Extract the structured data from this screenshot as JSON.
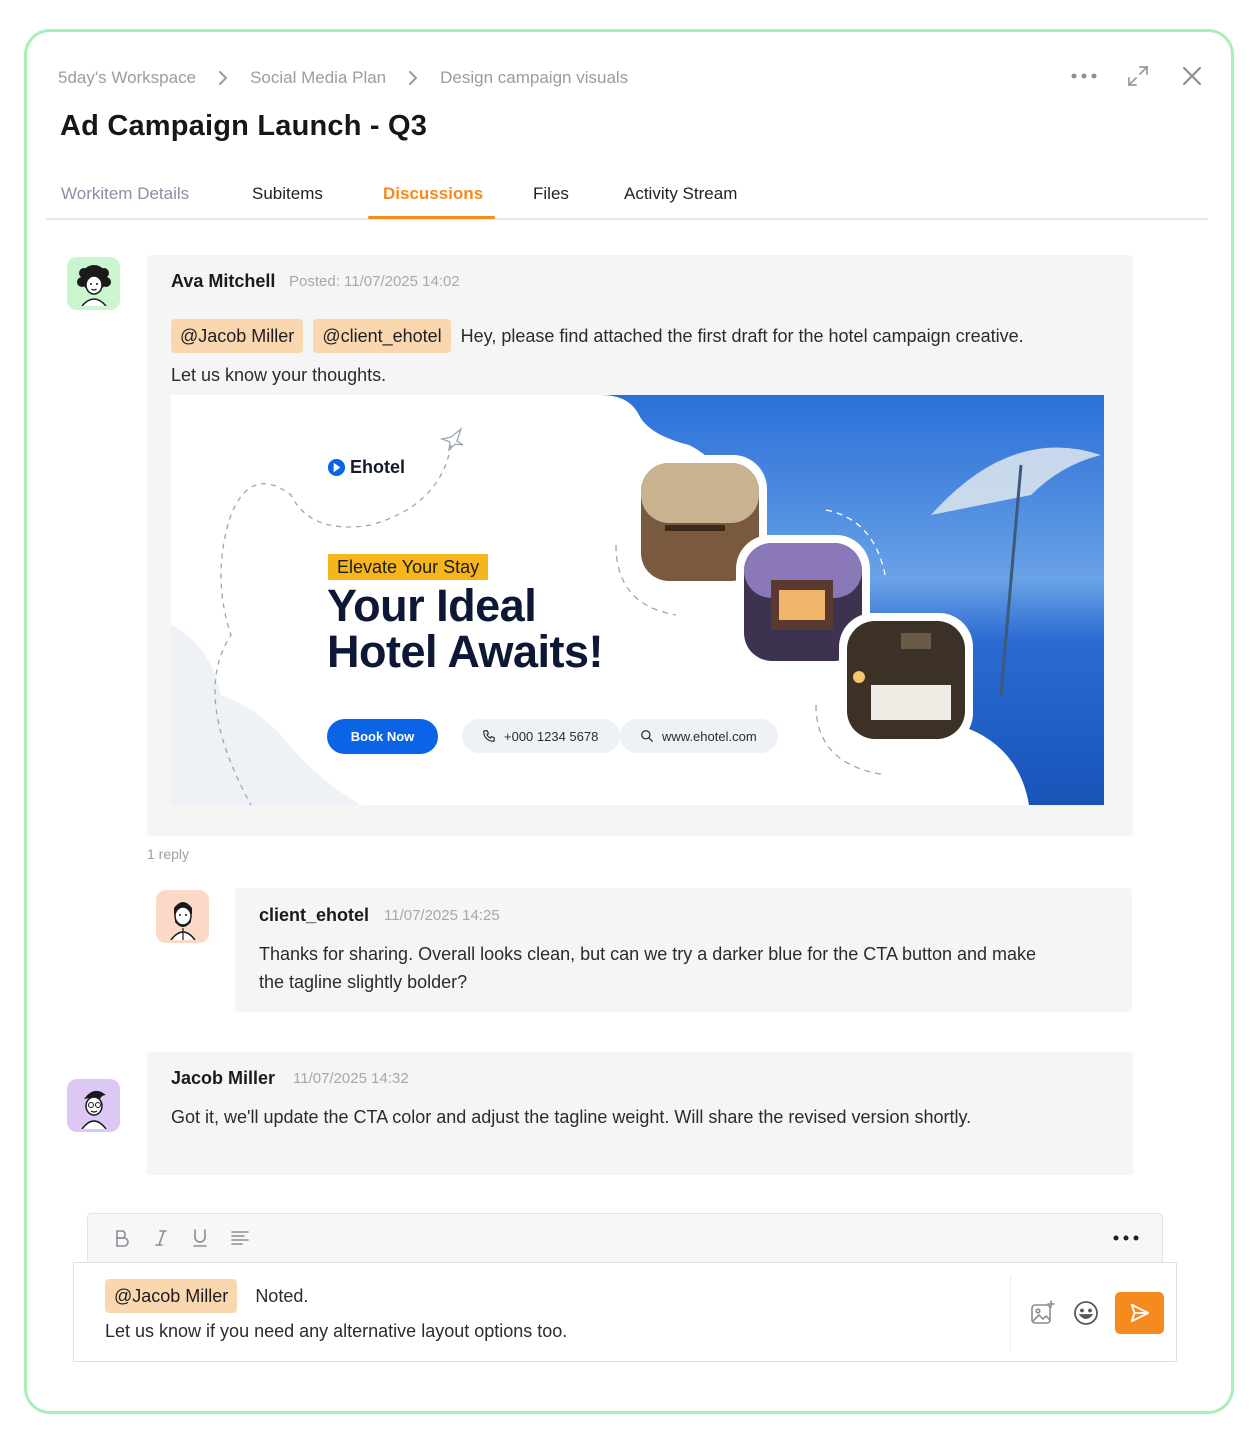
{
  "breadcrumb": [
    "5day's Workspace",
    "Social Media Plan",
    "Design campaign visuals"
  ],
  "title": "Ad Campaign Launch - Q3",
  "tabs": {
    "details": "Workitem Details",
    "subitems": "Subitems",
    "discussions": "Discussions",
    "files": "Files",
    "activity": "Activity Stream"
  },
  "colors": {
    "accent": "#f58a1f",
    "frame": "#a8f0b8",
    "mention_bg": "#fbd7b0",
    "cta_blue": "#0b63e5"
  },
  "post1": {
    "author": "Ava Mitchell",
    "posted": "Posted: 11/07/2025 14:02",
    "mention1": "@Jacob Miller",
    "mention2": "@client_ehotel",
    "text1": "Hey, please find attached the first draft for the hotel campaign creative.",
    "text2": "Let us know your thoughts.",
    "banner": {
      "brand": "Ehotel",
      "tagline": "Elevate Your Stay",
      "headline1": "Your Ideal",
      "headline2": "Hotel Awaits!",
      "cta": "Book Now",
      "phone": "+000 1234 5678",
      "website": "www.ehotel.com"
    },
    "reply_count": "1 reply"
  },
  "reply1": {
    "author": "client_ehotel",
    "posted": "11/07/2025 14:25",
    "text1": "Thanks for sharing. Overall looks clean, but can we try a darker blue for the CTA button and make",
    "text2": "the tagline slightly bolder?"
  },
  "post2": {
    "author": "Jacob Miller",
    "posted": "11/07/2025 14:32",
    "text": "Got it, we'll update the CTA color and adjust the tagline weight. Will share the revised version shortly."
  },
  "composer": {
    "mention": "@Jacob Miller",
    "text1": "Noted.",
    "text2": "Let us know if you need any alternative layout options too."
  },
  "toolbar_icons": [
    "bold-icon",
    "italic-icon",
    "underline-icon",
    "align-icon",
    "more-icon"
  ]
}
